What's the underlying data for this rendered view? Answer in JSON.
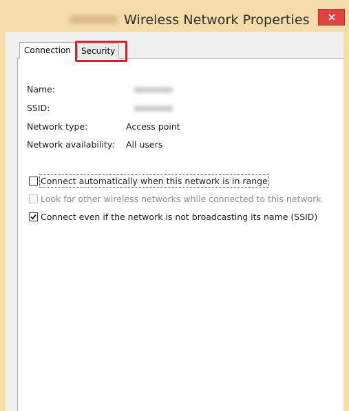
{
  "window": {
    "title": "Wireless Network Properties",
    "title_prefix_redacted": "CRESTEC",
    "close_icon": "close-x-icon",
    "colors": {
      "frame": "#f6dcab",
      "close": "#e04343",
      "highlight": "#d0242a"
    }
  },
  "tabs": [
    {
      "label": "Connection"
    },
    {
      "label": "Security",
      "highlighted": true
    }
  ],
  "properties": [
    {
      "label": "Name:",
      "value": "CRESTEC",
      "redacted": true
    },
    {
      "label": "SSID:",
      "value": "CRESTEC",
      "redacted": true
    },
    {
      "label": "Network type:",
      "value": "Access point"
    },
    {
      "label": "Network availability:",
      "value": "All users"
    }
  ],
  "options": [
    {
      "label": "Connect automatically when this network is in range",
      "checked": false,
      "enabled": true
    },
    {
      "label": "Look for other wireless networks while connected to this network",
      "checked": false,
      "enabled": false
    },
    {
      "label": "Connect even if the network is not broadcasting its name (SSID)",
      "checked": true,
      "enabled": true
    }
  ]
}
